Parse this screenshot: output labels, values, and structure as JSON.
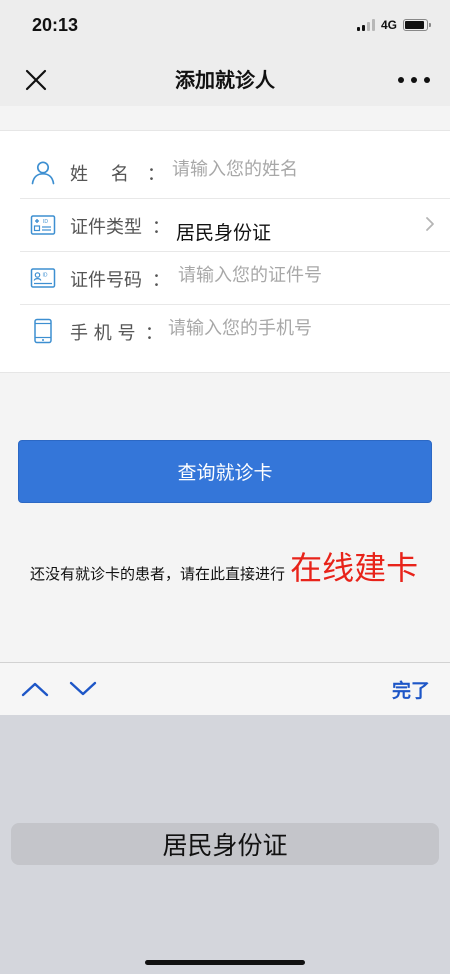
{
  "status_bar": {
    "time": "20:13",
    "network": "4G",
    "signal_bars_active": 2,
    "battery_level": 0.9
  },
  "nav": {
    "title": "添加就诊人",
    "close_icon": "close-icon",
    "more_icon": "more-icon"
  },
  "form": {
    "name": {
      "label": "姓    名",
      "colon": "：",
      "placeholder": "请输入您的姓名",
      "icon": "user-icon"
    },
    "id_type": {
      "label": "证件类型",
      "colon": "：",
      "value": "居民身份证",
      "icon": "id-card-icon"
    },
    "id_number": {
      "label": "证件号码",
      "colon": "：",
      "placeholder": "请输入您的证件号",
      "icon": "id-number-icon"
    },
    "phone": {
      "label": "手 机 号",
      "colon": "：",
      "placeholder": "请输入您的手机号",
      "icon": "phone-icon"
    }
  },
  "query_button": {
    "label": "查询就诊卡"
  },
  "hint": {
    "text": "还没有就诊卡的患者，请在此直接进行",
    "link": "在线建卡"
  },
  "picker_toolbar": {
    "done_label": "完了"
  },
  "picker": {
    "selected": "居民身份证"
  },
  "colors": {
    "primary_button": "#3476d9",
    "link_red": "#e8231a",
    "icon_blue": "#3d8fd1",
    "done_blue": "#1d56c7"
  }
}
